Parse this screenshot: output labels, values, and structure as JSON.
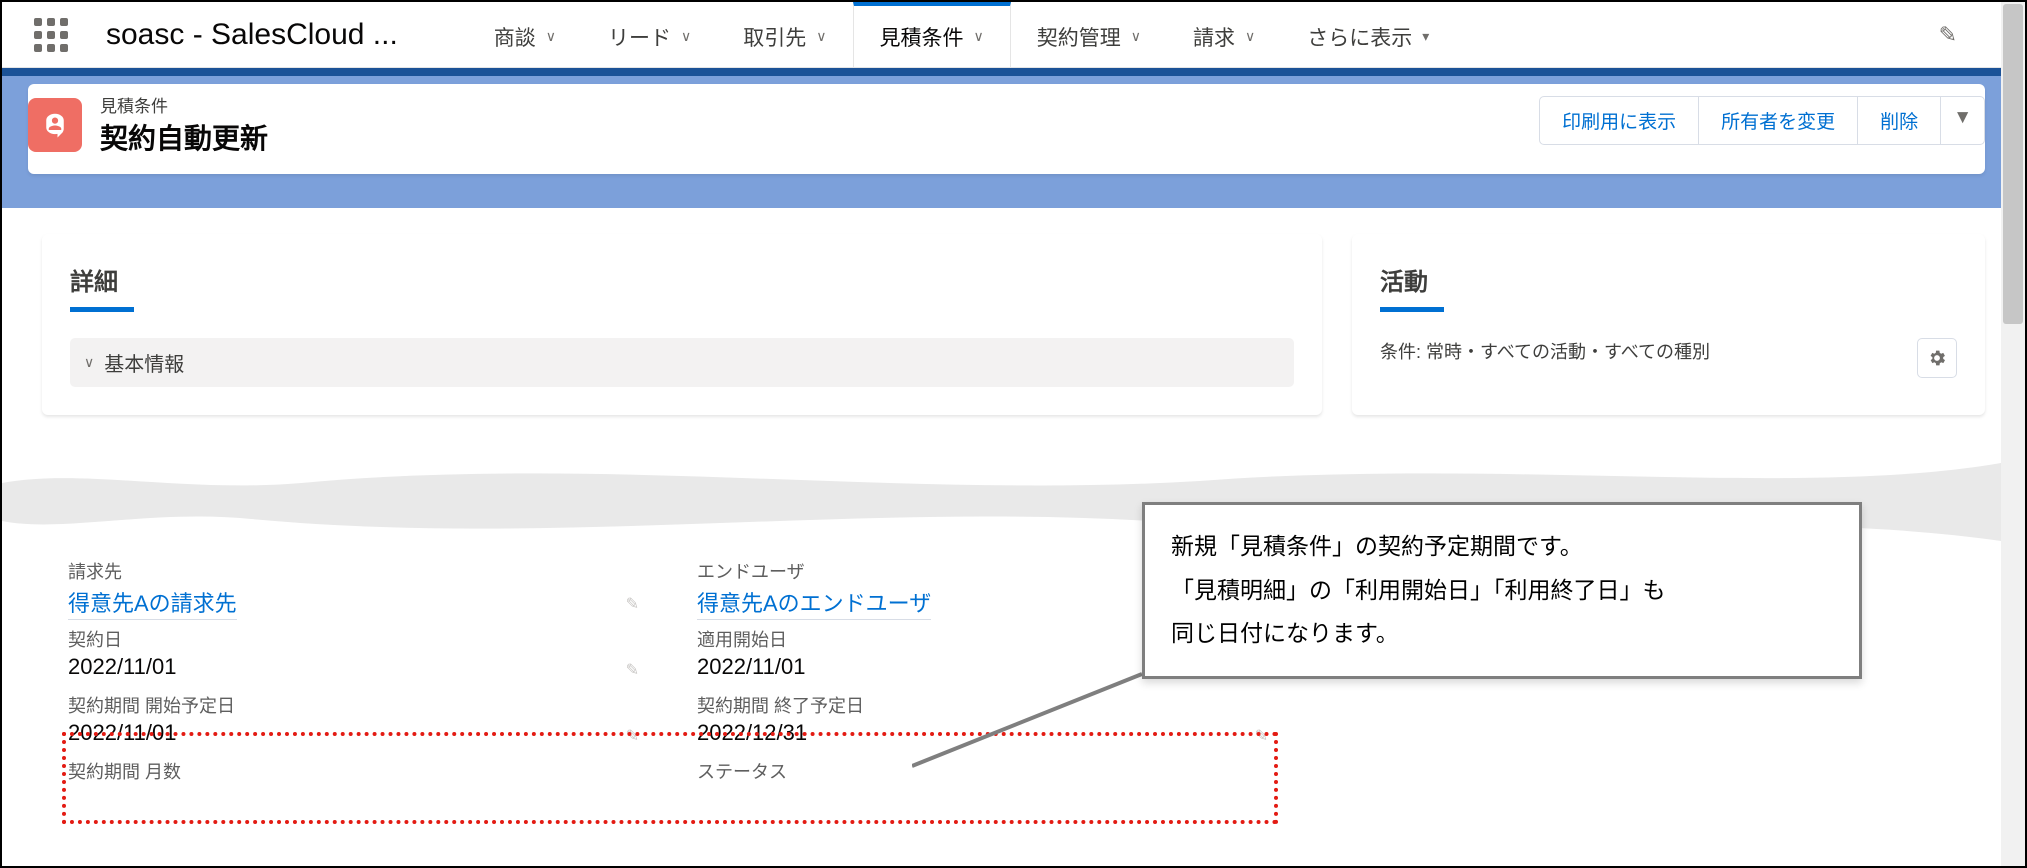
{
  "app_name": "soasc - SalesCloud ...",
  "nav": {
    "items": [
      {
        "label": "商談"
      },
      {
        "label": "リード"
      },
      {
        "label": "取引先"
      },
      {
        "label": "見積条件",
        "active": true
      },
      {
        "label": "契約管理"
      },
      {
        "label": "請求"
      },
      {
        "label": "さらに表示"
      }
    ]
  },
  "record": {
    "object_label": "見積条件",
    "name": "契約自動更新"
  },
  "actions": {
    "print": "印刷用に表示",
    "change_owner": "所有者を変更",
    "delete": "削除"
  },
  "left_card": {
    "title": "詳細",
    "section": "基本情報",
    "fields": {
      "billing_label": "請求先",
      "billing_value": "得意先Aの請求先",
      "enduser_label": "エンドユーザ",
      "enduser_value": "得意先Aのエンドユーザ",
      "contract_date_label": "契約日",
      "contract_date_value": "2022/11/01",
      "apply_start_label": "適用開始日",
      "apply_start_value": "2022/11/01",
      "period_start_label": "契約期間 開始予定日",
      "period_start_value": "2022/11/01",
      "period_end_label": "契約期間 終了予定日",
      "period_end_value": "2022/12/31",
      "period_months_label": "契約期間 月数",
      "status_label": "ステータス"
    }
  },
  "right_card": {
    "title": "活動",
    "filter_text": "条件: 常時・すべての活動・すべての種別"
  },
  "callout": {
    "line1": "新規「見積条件」の契約予定期間です。",
    "line2": "「見積明細」の「利用開始日」「利用終了日」も",
    "line3": "同じ日付になります。"
  }
}
